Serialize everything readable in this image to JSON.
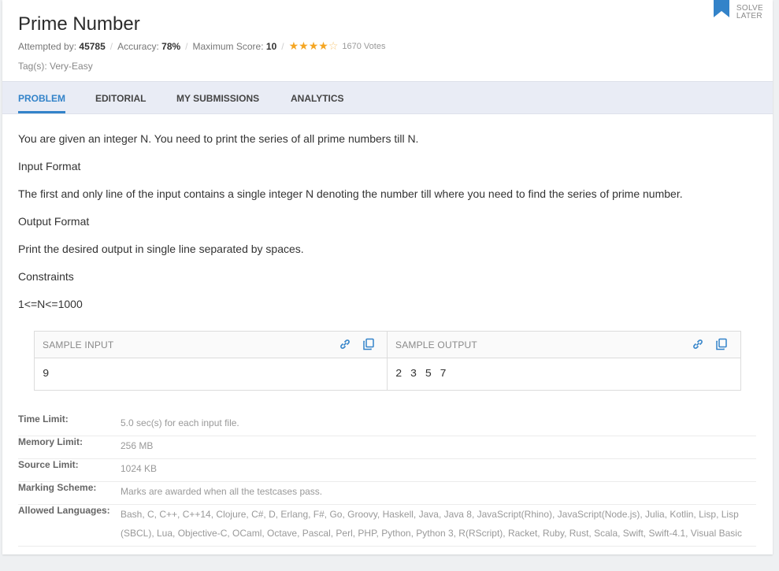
{
  "problem": {
    "title": "Prime Number",
    "attempted_label": "Attempted by:",
    "attempted_value": "45785",
    "accuracy_label": "Accuracy:",
    "accuracy_value": "78%",
    "max_score_label": "Maximum Score:",
    "max_score_value": "10",
    "rating_stars": 4,
    "rating_max": 5,
    "votes": "1670 Votes",
    "tags": "Tag(s): Very-Easy",
    "solve_later_line1": "SOLVE",
    "solve_later_line2": "LATER"
  },
  "tabs": [
    {
      "label": "PROBLEM",
      "active": true
    },
    {
      "label": "EDITORIAL",
      "active": false
    },
    {
      "label": "MY SUBMISSIONS",
      "active": false
    },
    {
      "label": "ANALYTICS",
      "active": false
    }
  ],
  "statement": [
    "You are given an integer N. You need to print the series of all prime numbers till N.",
    "Input Format",
    "The first and only line of the input contains a single integer N denoting the number till where you need to find the series of prime number.",
    "Output Format",
    "Print the desired output in single line separated by spaces.",
    "Constraints",
    "1<=N<=1000"
  ],
  "samples": {
    "input_label": "SAMPLE INPUT",
    "input_value": "9",
    "output_label": "SAMPLE OUTPUT",
    "output_value": "2 3 5 7"
  },
  "limits": [
    {
      "key": "Time Limit:",
      "value": "5.0 sec(s) for each input file."
    },
    {
      "key": "Memory Limit:",
      "value": "256 MB"
    },
    {
      "key": "Source Limit:",
      "value": "1024 KB"
    },
    {
      "key": "Marking Scheme:",
      "value": "Marks are awarded when all the testcases pass."
    },
    {
      "key": "Allowed Languages:",
      "value": "Bash, C, C++, C++14, Clojure, C#, D, Erlang, F#, Go, Groovy, Haskell, Java, Java 8, JavaScript(Rhino), JavaScript(Node.js), Julia, Kotlin, Lisp, Lisp (SBCL), Lua, Objective-C, OCaml, Octave, Pascal, Perl, PHP, Python, Python 3, R(RScript), Racket, Ruby, Rust, Scala, Swift, Swift-4.1, Visual Basic"
    }
  ],
  "colors": {
    "accent": "#3383c9",
    "star": "#f5a623",
    "tab_bar": "#e9ecf5"
  }
}
